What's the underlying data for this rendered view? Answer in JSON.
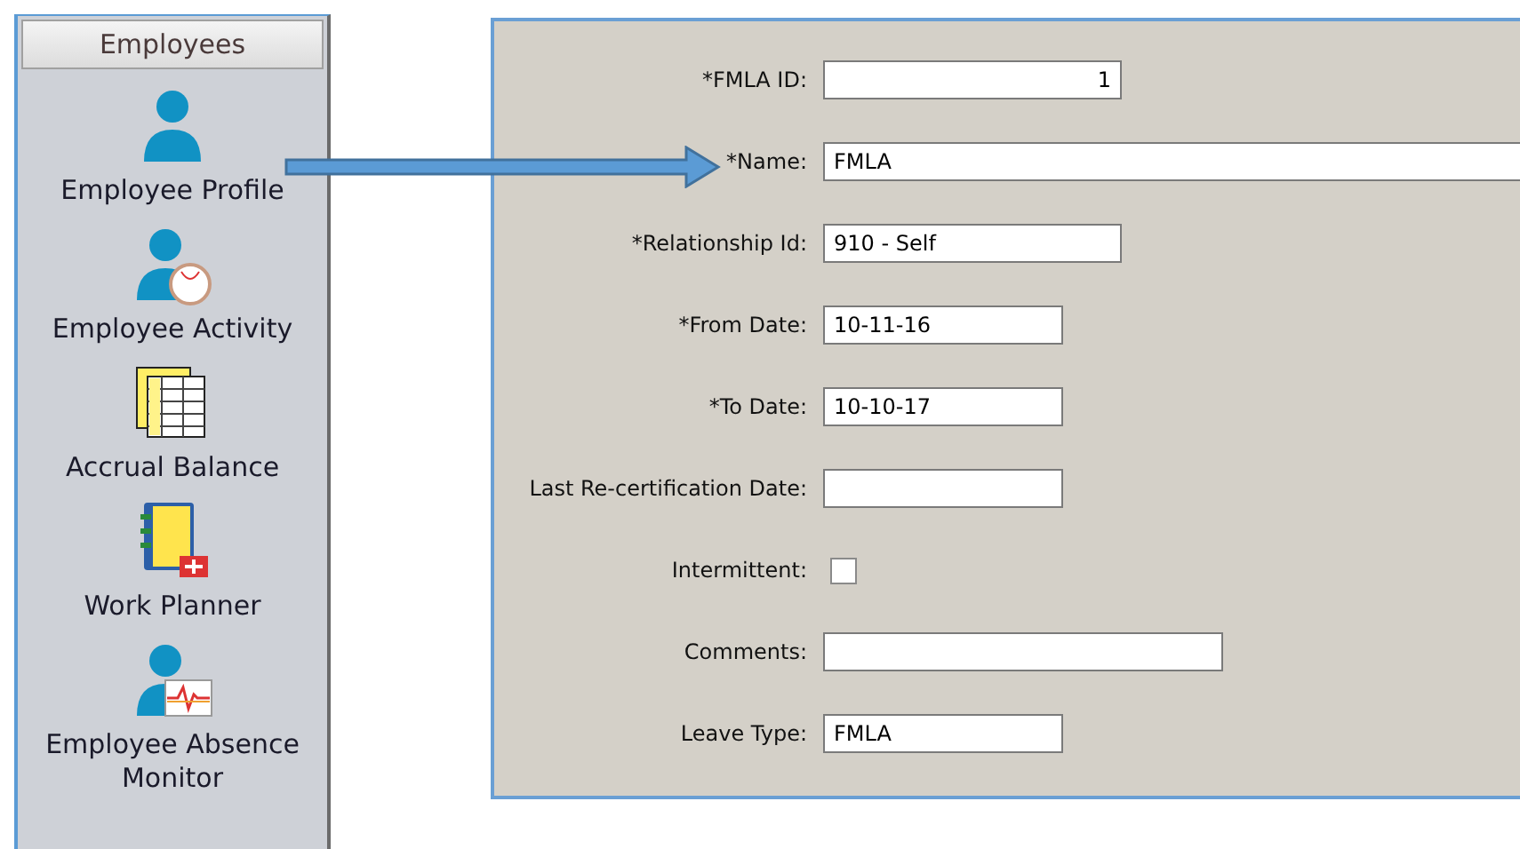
{
  "sidebar": {
    "title": "Employees",
    "items": [
      {
        "label": "Employee Profile",
        "kind": "profile"
      },
      {
        "label": "Employee Activity",
        "kind": "activity"
      },
      {
        "label": "Accrual Balance",
        "kind": "sheet"
      },
      {
        "label": "Work Planner",
        "kind": "planner"
      },
      {
        "label": "Employee Absence Monitor",
        "kind": "monitor"
      }
    ]
  },
  "form": {
    "fields": [
      {
        "label": "*FMLA ID:",
        "kind": "number",
        "value": "1"
      },
      {
        "label": "*Name:",
        "kind": "text",
        "value": "FMLA"
      },
      {
        "label": "*Relationship Id:",
        "kind": "text",
        "value": "910 - Self"
      },
      {
        "label": "*From Date:",
        "kind": "text",
        "value": "10-11-16"
      },
      {
        "label": "*To Date:",
        "kind": "text",
        "value": "10-10-17"
      },
      {
        "label": "Last Re-certification Date:",
        "kind": "text"
      },
      {
        "label": "Intermittent:",
        "kind": "checkbox",
        "checked": false
      },
      {
        "label": "Comments:",
        "kind": "text"
      },
      {
        "label": "Leave Type:",
        "kind": "text",
        "value": "FMLA"
      }
    ]
  }
}
